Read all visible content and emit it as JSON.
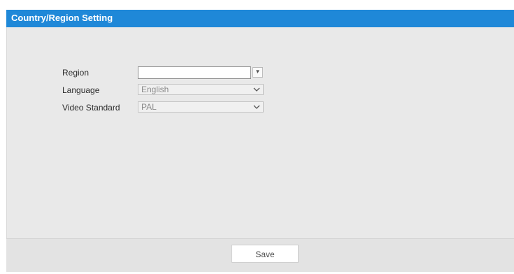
{
  "header": {
    "title": "Country/Region Setting",
    "color": "#1f88d8"
  },
  "form": {
    "region": {
      "label": "Region",
      "value": "",
      "dropdown_icon": "triangle-down-icon"
    },
    "language": {
      "label": "Language",
      "value": "English",
      "icon": "chevron-down-icon"
    },
    "video_standard": {
      "label": "Video Standard",
      "value": "PAL",
      "icon": "chevron-down-icon"
    }
  },
  "footer": {
    "save_label": "Save"
  }
}
